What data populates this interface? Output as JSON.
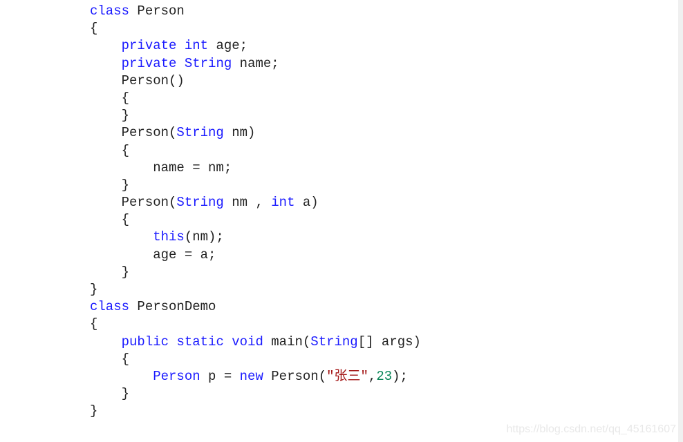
{
  "code": {
    "lines": [
      [
        [
          "kw",
          "class"
        ],
        [
          "pl",
          " Person"
        ]
      ],
      [
        [
          "pl",
          "{"
        ]
      ],
      [
        [
          "pl",
          "    "
        ],
        [
          "kw",
          "private"
        ],
        [
          "pl",
          " "
        ],
        [
          "kw",
          "int"
        ],
        [
          "pl",
          " age;"
        ]
      ],
      [
        [
          "pl",
          "    "
        ],
        [
          "kw",
          "private"
        ],
        [
          "pl",
          " "
        ],
        [
          "kw",
          "String"
        ],
        [
          "pl",
          " name;"
        ]
      ],
      [
        [
          "pl",
          "    Person()"
        ]
      ],
      [
        [
          "pl",
          "    {"
        ]
      ],
      [
        [
          "pl",
          "    }"
        ]
      ],
      [
        [
          "pl",
          "    Person("
        ],
        [
          "kw",
          "String"
        ],
        [
          "pl",
          " nm)"
        ]
      ],
      [
        [
          "pl",
          "    {"
        ]
      ],
      [
        [
          "pl",
          "        name = nm;"
        ]
      ],
      [
        [
          "pl",
          "    }"
        ]
      ],
      [
        [
          "pl",
          "    Person("
        ],
        [
          "kw",
          "String"
        ],
        [
          "pl",
          " nm , "
        ],
        [
          "kw",
          "int"
        ],
        [
          "pl",
          " a)"
        ]
      ],
      [
        [
          "pl",
          "    {"
        ]
      ],
      [
        [
          "pl",
          "        "
        ],
        [
          "kw",
          "this"
        ],
        [
          "pl",
          "(nm);"
        ]
      ],
      [
        [
          "pl",
          "        age = a;"
        ]
      ],
      [
        [
          "pl",
          "    }"
        ]
      ],
      [
        [
          "pl",
          "}"
        ]
      ],
      [
        [
          "kw",
          "class"
        ],
        [
          "pl",
          " PersonDemo"
        ]
      ],
      [
        [
          "pl",
          "{"
        ]
      ],
      [
        [
          "pl",
          "    "
        ],
        [
          "kw",
          "public"
        ],
        [
          "pl",
          " "
        ],
        [
          "kw",
          "static"
        ],
        [
          "pl",
          " "
        ],
        [
          "kw",
          "void"
        ],
        [
          "pl",
          " main("
        ],
        [
          "kw",
          "String"
        ],
        [
          "pl",
          "[] args)"
        ]
      ],
      [
        [
          "pl",
          "    {"
        ]
      ],
      [
        [
          "pl",
          "        "
        ],
        [
          "kw",
          "Person"
        ],
        [
          "pl",
          " p = "
        ],
        [
          "kw",
          "new"
        ],
        [
          "pl",
          " Person("
        ],
        [
          "str",
          "\"张三\""
        ],
        [
          "pl",
          ","
        ],
        [
          "num",
          "23"
        ],
        [
          "pl",
          ");"
        ]
      ],
      [
        [
          "pl",
          "    }"
        ]
      ],
      [
        [
          "pl",
          "}"
        ]
      ]
    ]
  },
  "watermark": "https://blog.csdn.net/qq_45161607",
  "colors": {
    "keyword": "#1a1aff",
    "string": "#a31515",
    "number": "#098658",
    "text": "#222222"
  }
}
